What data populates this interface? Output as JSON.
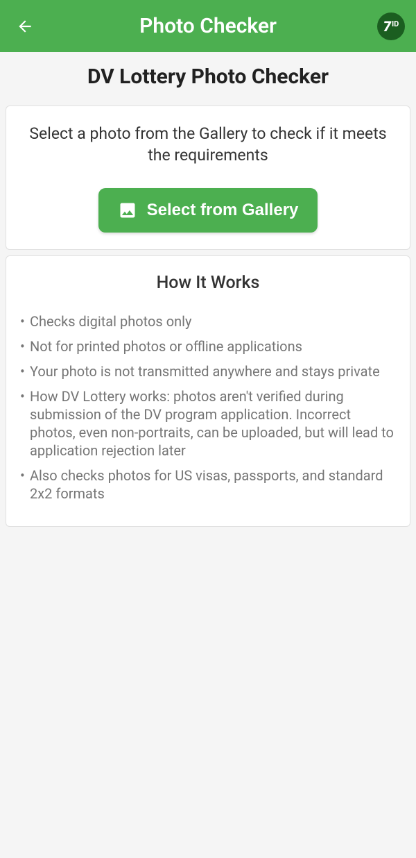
{
  "header": {
    "title": "Photo Checker",
    "logo_text": "7ID"
  },
  "page": {
    "title": "DV Lottery Photo Checker"
  },
  "select_card": {
    "instruction": "Select a photo from the Gallery to check if it meets the requirements",
    "button_label": "Select from Gallery"
  },
  "info_card": {
    "title": "How It Works",
    "items": [
      "Checks digital photos only",
      "Not for printed photos or offline applications",
      "Your photo is not transmitted anywhere and stays private",
      "How DV Lottery works: photos aren't verified during submission of the DV program application. Incorrect photos, even non-portraits, can be uploaded, but will lead to application rejection later",
      "Also checks photos for US visas, passports, and standard 2x2 formats"
    ]
  }
}
